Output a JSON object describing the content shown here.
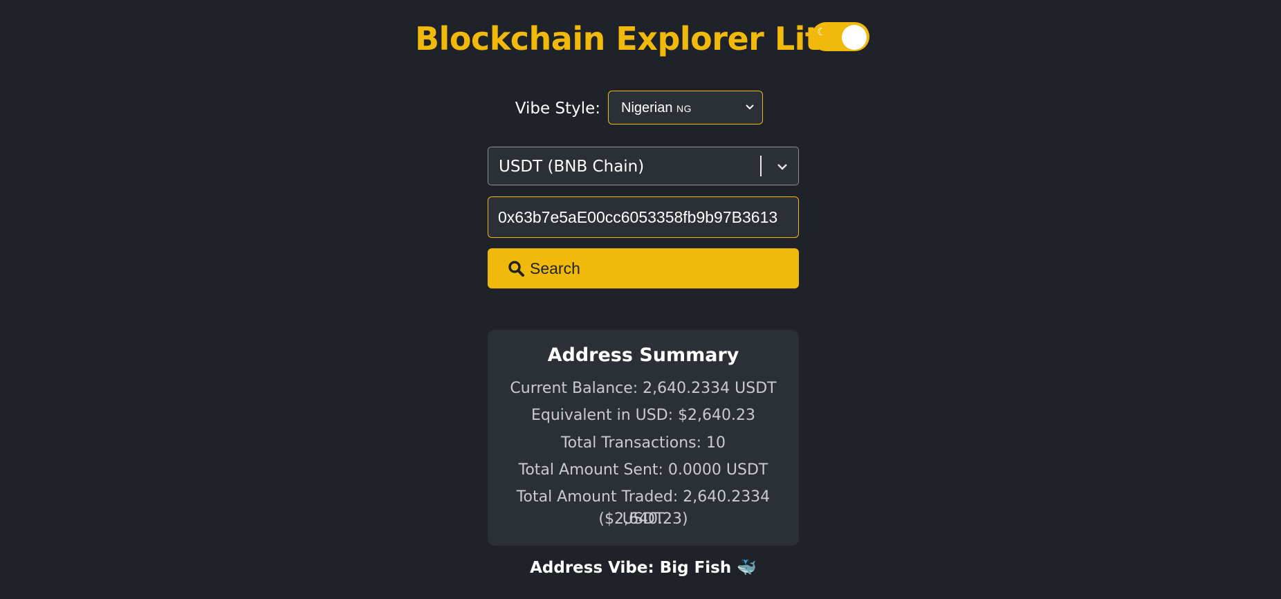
{
  "header": {
    "title": "Blockchain Explorer Lite",
    "theme_toggle_icon": "moon-icon"
  },
  "vibe": {
    "label": "Vibe Style:",
    "selected": "Nigerian",
    "flag": "NG"
  },
  "chain": {
    "selected": "USDT (BNB Chain)"
  },
  "search": {
    "address_value": "0x63b7e5aE00cc6053358fb9b97B3613",
    "button_label": "Search",
    "icon": "search-icon"
  },
  "summary": {
    "title": "Address Summary",
    "current_balance": "Current Balance: 2,640.2334 USDT",
    "equivalent_usd": "Equivalent in USD: $2,640.23",
    "total_transactions": "Total Transactions: 10",
    "total_sent": "Total Amount Sent: 0.0000 USDT",
    "total_traded_line1": "Total Amount Traded: 2,640.2334 USDT",
    "total_traded_line2": "($2,640.23)"
  },
  "address_vibe": {
    "text": "Address Vibe: Big Fish 🐳"
  },
  "colors": {
    "background": "#1f2228",
    "accent": "#f0b90b",
    "card": "#2b2f36"
  }
}
